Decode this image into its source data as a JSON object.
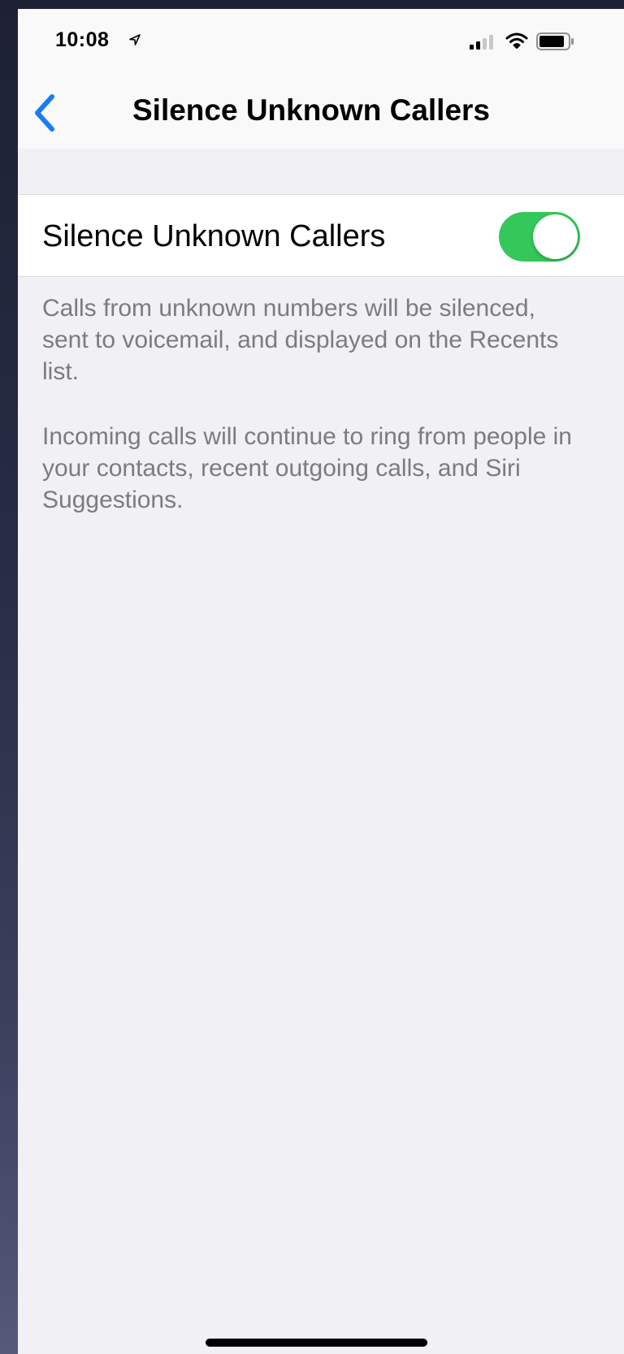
{
  "status_bar": {
    "time": "10:08"
  },
  "nav": {
    "title": "Silence Unknown Callers"
  },
  "settings": {
    "toggle_label": "Silence Unknown Callers",
    "toggle_on": true,
    "toggle_color": "#34c759",
    "footer_paragraph_1": "Calls from unknown numbers will be silenced, sent to voicemail, and displayed on the Recents list.",
    "footer_paragraph_2": "Incoming calls will continue to ring from people in your contacts, recent outgoing calls, and Siri Suggestions."
  },
  "colors": {
    "accent_blue": "#1a7cf5",
    "background": "#f0f0f5"
  }
}
